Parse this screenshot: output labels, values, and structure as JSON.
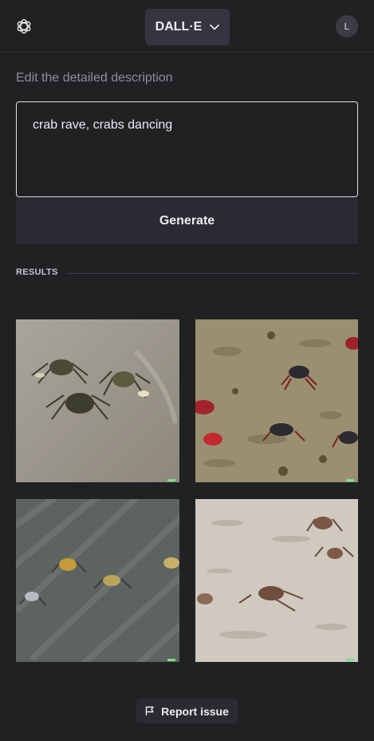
{
  "header": {
    "model_label": "DALL·E",
    "avatar_initial": "L"
  },
  "editor": {
    "label": "Edit the detailed description",
    "prompt_value": "crab rave, crabs dancing",
    "generate_label": "Generate"
  },
  "results": {
    "section_label": "RESULTS",
    "images": [
      {
        "alt": "crabs on smooth sand"
      },
      {
        "alt": "red crabs on wet mudflat"
      },
      {
        "alt": "crabs on dark rippled sand"
      },
      {
        "alt": "crabs on pale beach sand"
      }
    ]
  },
  "footer": {
    "report_label": "Report issue"
  },
  "colors": {
    "background": "#202123",
    "button_bg": "#343541",
    "generate_bg": "#2a2b32",
    "muted_text": "#8e8ea0"
  }
}
